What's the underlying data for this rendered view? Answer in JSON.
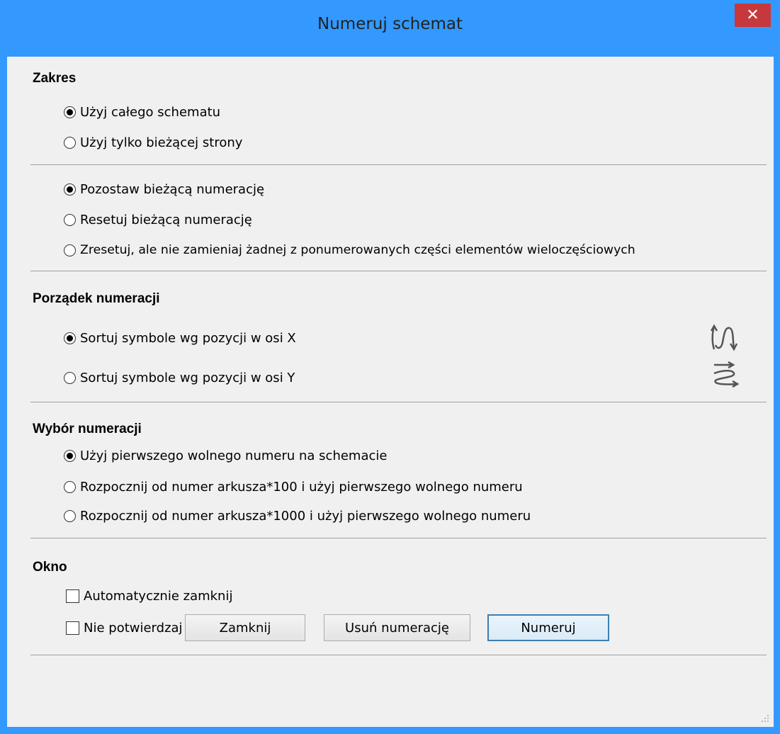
{
  "window": {
    "title": "Numeruj schemat",
    "close_symbol": "✕"
  },
  "zakres": {
    "title": "Zakres",
    "scope_options": [
      {
        "label": "Użyj całego schematu",
        "checked": true
      },
      {
        "label": "Użyj tylko bieżącej strony",
        "checked": false
      }
    ],
    "reset_options": [
      {
        "label": "Pozostaw bieżącą numerację",
        "checked": true
      },
      {
        "label": "Resetuj bieżącą numerację",
        "checked": false
      },
      {
        "label": "Zresetuj, ale nie zamieniaj żadnej z ponumerowanych części elementów wieloczęściowych",
        "checked": false
      }
    ]
  },
  "order": {
    "title": "Porządek numeracji",
    "options": [
      {
        "label": "Sortuj symbole wg pozycji w osi X",
        "checked": true,
        "icon": "sort-x-icon"
      },
      {
        "label": "Sortuj symbole wg pozycji w osi Y",
        "checked": false,
        "icon": "sort-y-icon"
      }
    ]
  },
  "choice": {
    "title": "Wybór numeracji",
    "options": [
      {
        "label": "Użyj pierwszego wolnego numeru na schemacie",
        "checked": true
      },
      {
        "label": "Rozpocznij od numer arkusza*100 i użyj pierwszego wolnego numeru",
        "checked": false
      },
      {
        "label": "Rozpocznij od numer arkusza*1000 i użyj pierwszego wolnego numeru",
        "checked": false
      }
    ]
  },
  "okno": {
    "title": "Okno",
    "checkboxes": [
      {
        "label": "Automatycznie zamknij",
        "checked": false
      },
      {
        "label": "Nie potwierdzaj",
        "checked": false
      }
    ]
  },
  "buttons": {
    "close": "Zamknij",
    "remove": "Usuń numerację",
    "number": "Numeruj"
  },
  "colors": {
    "titlebar": "#3399ff",
    "close_button": "#c7383c",
    "client": "#f0f0f0"
  }
}
